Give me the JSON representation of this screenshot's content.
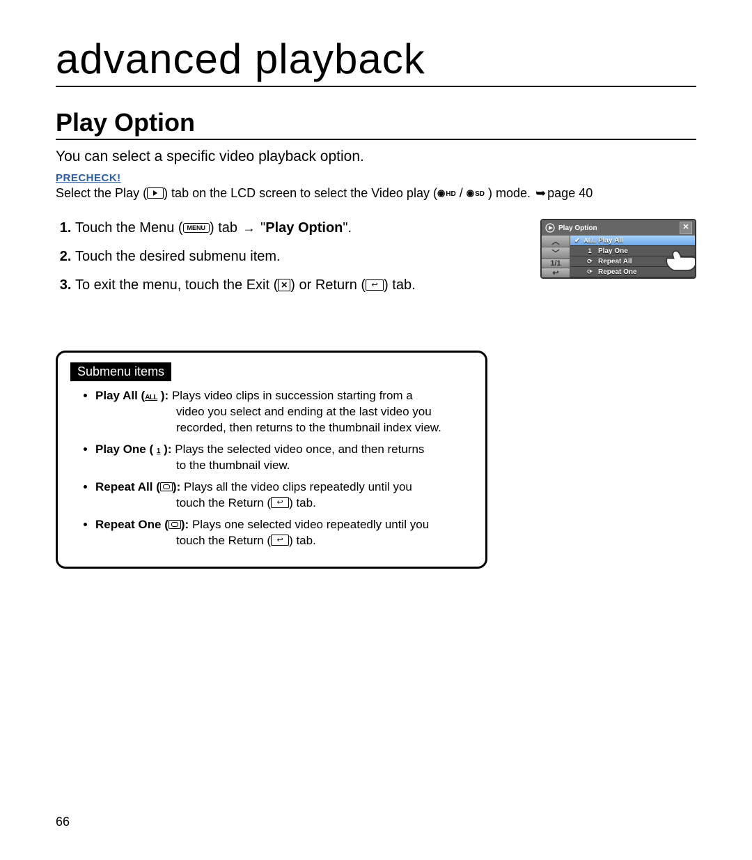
{
  "chapter_title": "advanced playback",
  "section_title": "Play Option",
  "intro_text": "You can select a specific video playback option.",
  "precheck": {
    "label": "PRECHECK!",
    "pre": "Select the Play (",
    "mid": ") tab on the LCD screen to select the Video play (",
    "hd": "HD",
    "slash": " /",
    "sd": "SD",
    "post": " ) mode. ",
    "page_ref": "page 40"
  },
  "steps": [
    {
      "pre": "Touch the Menu (",
      "menu_label": "MENU",
      "mid": ") tab ",
      "arrow": "→",
      "quote_open": " \"",
      "target_bold": "Play Option",
      "quote_close": "\"."
    },
    {
      "text_full": "Touch the desired submenu item."
    },
    {
      "pre": "To exit the menu, touch the Exit (",
      "x": "✕",
      "mid": ") or Return (",
      "ret": "↩",
      "post": ") tab."
    }
  ],
  "lcd": {
    "title": "Play Option",
    "close": "✕",
    "side": {
      "up": "︿",
      "down": "﹀",
      "page": "1/1",
      "back": "↩"
    },
    "rows": [
      {
        "check": "✔",
        "icon": "ALL",
        "label": "Play All",
        "selected": true
      },
      {
        "check": "",
        "icon": "1",
        "label": "Play One",
        "selected": false
      },
      {
        "check": "",
        "icon": "⟳",
        "label": "Repeat All",
        "selected": false
      },
      {
        "check": "",
        "icon": "⟳",
        "label": "Repeat One",
        "selected": false
      }
    ]
  },
  "submenu": {
    "title": "Submenu items",
    "items": [
      {
        "name": "Play All",
        "icon": "ALL",
        "first": " Plays video clips in succession starting from a",
        "rest": "video you select and ending at the last video you recorded, then returns to the thumbnail index view."
      },
      {
        "name": "Play One",
        "icon": "1",
        "first": " Plays the selected video once, and then returns",
        "rest": "to the thumbnail view."
      },
      {
        "name": "Repeat All",
        "icon": "repeat",
        "first": " Plays all the video clips repeatedly until you",
        "rest_pre": "touch the Return (",
        "rest_ret": "↩",
        "rest_post": ") tab."
      },
      {
        "name": "Repeat One",
        "icon": "repeat",
        "first": " Plays one selected video repeatedly until you",
        "rest_pre": "touch the Return (",
        "rest_ret": "↩",
        "rest_post": ") tab."
      }
    ]
  },
  "page_number": "66"
}
